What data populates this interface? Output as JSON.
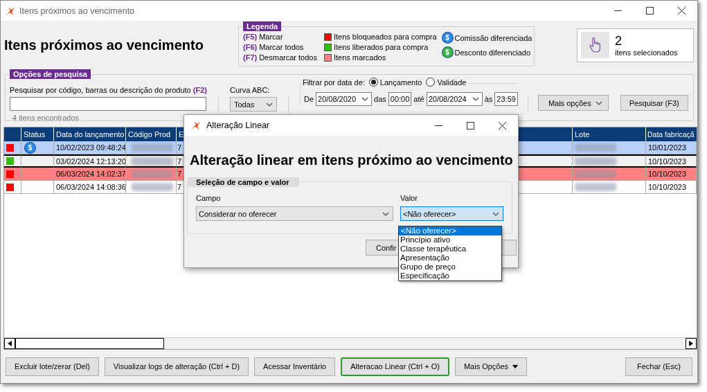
{
  "window": {
    "title": "Itens próximos ao vencimento"
  },
  "heading": "Itens próximos ao vencimento",
  "legend": {
    "title": "Legenda",
    "shortcuts": [
      {
        "key": "(F5)",
        "label": "Marcar"
      },
      {
        "key": "(F6)",
        "label": "Marcar todos"
      },
      {
        "key": "(F7)",
        "label": "Desmarcar todos"
      }
    ],
    "colors": [
      {
        "label": "Itens bloqueados para compra",
        "color": "#ff0000"
      },
      {
        "label": "Itens liberados para compra",
        "color": "#33bb11"
      },
      {
        "label": "Itens marcados",
        "color": "#ff8080"
      }
    ],
    "badges": [
      {
        "symbol": "$",
        "label": "Comissão diferenciada",
        "color": "#2a8ae6"
      },
      {
        "symbol": "$",
        "label": "Desconto diferenciado",
        "color": "#3bb44a"
      }
    ]
  },
  "selection": {
    "count": "2",
    "label": "itens selecionados"
  },
  "search": {
    "title": "Opções de pesquisa",
    "label": "Pesquisar por código, barras ou descrição do produto",
    "shortcut": "(F2)",
    "result": "4 itens encontrados"
  },
  "curve": {
    "label": "Curva ABC:",
    "value": "Todas"
  },
  "date_filter": {
    "label": "Filtrar por data de:",
    "options": [
      {
        "label": "Lançamento",
        "selected": true
      },
      {
        "label": "Validade",
        "selected": false
      }
    ],
    "from_label": "De",
    "from_date": "20/08/2020",
    "from_time_label": "das",
    "from_time": "00:00",
    "to_label": "até",
    "to_date": "20/08/2024",
    "to_time_label": "às",
    "to_time": "23:59"
  },
  "more_options": "Mais opções",
  "search_button": "Pesquisar (F3)",
  "table": {
    "columns": [
      "Status",
      "Data do lançamento",
      "Código Prod",
      "E",
      "Lote",
      "Data fabricaçã"
    ],
    "rows": [
      {
        "kind": "selected",
        "color": "#ff0000",
        "status": {
          "symbol": "$",
          "color": "#2a8ae6"
        },
        "launch_date": "10/02/2023 09:48:24",
        "column_e": "7",
        "manufacture_date": "10/01/2023"
      },
      {
        "kind": "focused",
        "color": "#33bb11",
        "launch_date": "03/02/2024 12:13:20",
        "column_e": "7",
        "manufacture_date": "10/10/2023"
      },
      {
        "kind": "marked",
        "color": "#ff0000",
        "launch_date": "06/03/2024 14:02:37",
        "column_e": "7",
        "manufacture_date": "10/10/2023"
      },
      {
        "kind": "plain",
        "color": "#ff0000",
        "launch_date": "06/03/2024 14:08:36",
        "column_e": "7",
        "manufacture_date": "10/10/2023"
      }
    ]
  },
  "buttons": [
    {
      "label": "Excluir lote/zerar (Del)",
      "kind": "plain",
      "focused": false
    },
    {
      "label": "Visualizar logs de alteração (Ctrl + D)",
      "kind": "plain",
      "focused": false
    },
    {
      "label": "Acessar Inventário",
      "kind": "plain",
      "focused": false
    },
    {
      "label": "Alteracao Linear (Ctrl + O)",
      "kind": "plain",
      "focused": true
    },
    {
      "label": "Mais Opções",
      "kind": "menu",
      "focused": false
    },
    {
      "label": "Fechar (Esc)",
      "kind": "right",
      "focused": false
    }
  ],
  "dialog": {
    "title": "Alteração Linear",
    "heading": "Alteração linear em itens próximo ao vencimento",
    "group_title": "Seleção de campo e valor",
    "field_label": "Campo",
    "field_value": "Considerar no oferecer",
    "value_label": "Valor",
    "value_value": "<Não oferecer>",
    "options": [
      {
        "label": "<Não oferecer>",
        "selected": true
      },
      {
        "label": "Princípio ativo",
        "selected": false
      },
      {
        "label": "Classe terapêutica",
        "selected": false
      },
      {
        "label": "Apresentação",
        "selected": false
      },
      {
        "label": "Grupo de preço",
        "selected": false
      },
      {
        "label": "Especificação",
        "selected": false
      }
    ],
    "confirm_label": "Confir"
  }
}
